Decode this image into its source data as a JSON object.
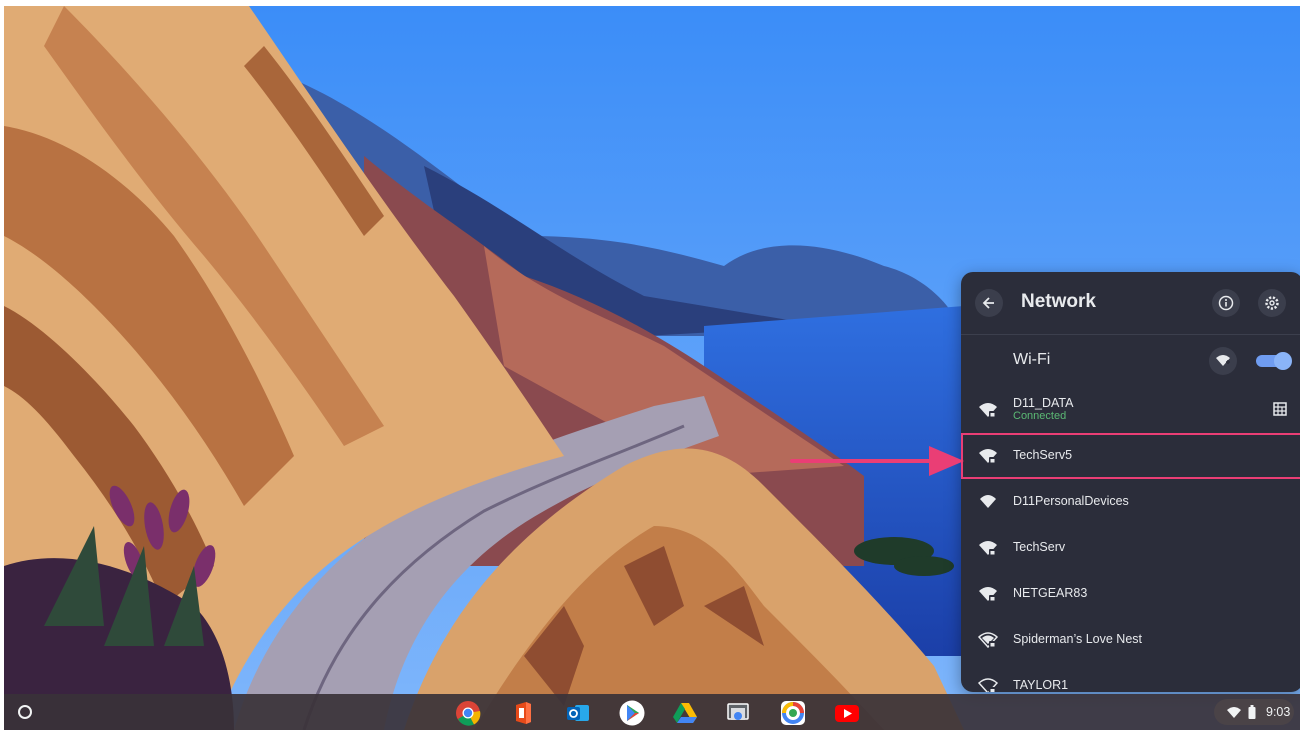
{
  "panel": {
    "title": "Network",
    "wifi_label": "Wi-Fi",
    "wifi_enabled": true,
    "networks": [
      {
        "name": "D11_DATA",
        "status": "Connected",
        "secured": true
      },
      {
        "name": "TechServ5",
        "secured": true
      },
      {
        "name": "D11PersonalDevices",
        "secured": false
      },
      {
        "name": "TechServ",
        "secured": true
      },
      {
        "name": "NETGEAR83",
        "secured": true
      },
      {
        "name": "Spiderman’s Love Nest",
        "secured": true
      },
      {
        "name": "TAYLOR1",
        "secured": true
      }
    ]
  },
  "shelf": {
    "apps": [
      "chrome-icon",
      "office-icon",
      "outlook-icon",
      "play-store-icon",
      "drive-icon",
      "chrome-remote-desktop-icon",
      "camera-icon",
      "youtube-icon"
    ],
    "time": "9:03"
  },
  "colors": {
    "panel_bg": "#2b2d3a",
    "highlight": "#ea3e75",
    "connected": "#5bb974",
    "toggle": "#8ab4f8"
  }
}
